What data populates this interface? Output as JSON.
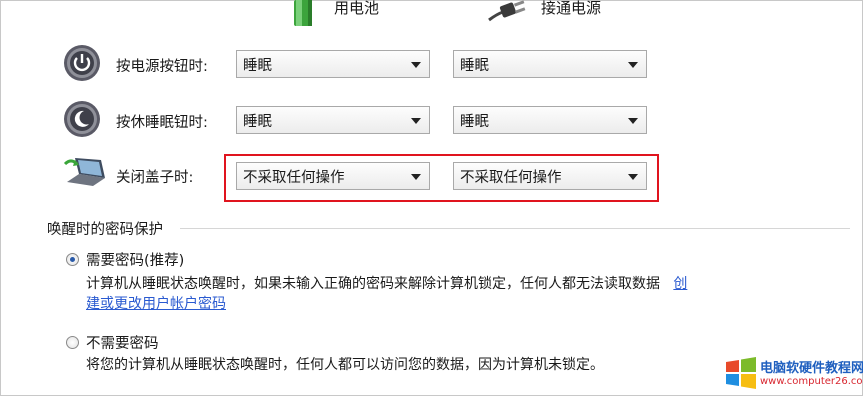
{
  "columns": {
    "battery_label": "用电池",
    "plugged_label": "接通电源"
  },
  "rows": [
    {
      "label": "按电源按钮时:",
      "battery_value": "睡眠",
      "plugged_value": "睡眠"
    },
    {
      "label": "按休睡眠钮时:",
      "battery_value": "睡眠",
      "plugged_value": "睡眠"
    },
    {
      "label": "关闭盖子时:",
      "battery_value": "不采取任何操作",
      "plugged_value": "不采取任何操作"
    }
  ],
  "password_section": {
    "title": "唤醒时的密码保护",
    "require": {
      "label": "需要密码(推荐)",
      "desc_line1": "计算机从睡眠状态唤醒时，如果未输入正确的密码来解除计算机锁定，任何人都无法读取数据",
      "link_part1": "创",
      "link_part2": "建或更改用户帐户密码"
    },
    "no_require": {
      "label": "不需要密码",
      "desc": "将您的计算机从睡眠状态唤醒时，任何人都可以访问您的数据，因为计算机未锁定。"
    }
  },
  "watermark": {
    "title": "电脑软硬件教程网",
    "url": "www.computer26.com"
  },
  "colors": {
    "highlight": "#e0141e",
    "link": "#2a5ad0",
    "radio_dot": "#2a5aa8"
  }
}
